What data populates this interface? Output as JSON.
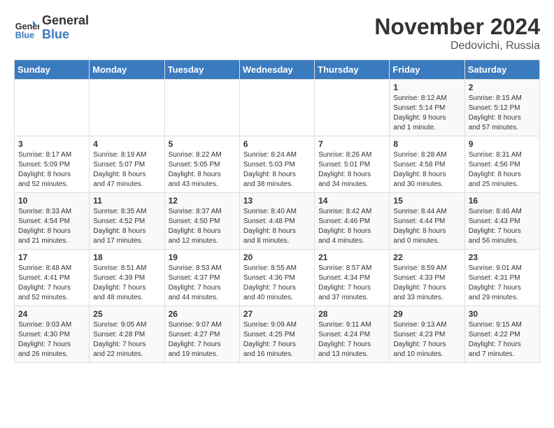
{
  "header": {
    "logo_line1": "General",
    "logo_line2": "Blue",
    "title": "November 2024",
    "location": "Dedovichi, Russia"
  },
  "days_of_week": [
    "Sunday",
    "Monday",
    "Tuesday",
    "Wednesday",
    "Thursday",
    "Friday",
    "Saturday"
  ],
  "weeks": [
    [
      {
        "day": "",
        "info": ""
      },
      {
        "day": "",
        "info": ""
      },
      {
        "day": "",
        "info": ""
      },
      {
        "day": "",
        "info": ""
      },
      {
        "day": "",
        "info": ""
      },
      {
        "day": "1",
        "info": "Sunrise: 8:12 AM\nSunset: 5:14 PM\nDaylight: 9 hours\nand 1 minute."
      },
      {
        "day": "2",
        "info": "Sunrise: 8:15 AM\nSunset: 5:12 PM\nDaylight: 8 hours\nand 57 minutes."
      }
    ],
    [
      {
        "day": "3",
        "info": "Sunrise: 8:17 AM\nSunset: 5:09 PM\nDaylight: 8 hours\nand 52 minutes."
      },
      {
        "day": "4",
        "info": "Sunrise: 8:19 AM\nSunset: 5:07 PM\nDaylight: 8 hours\nand 47 minutes."
      },
      {
        "day": "5",
        "info": "Sunrise: 8:22 AM\nSunset: 5:05 PM\nDaylight: 8 hours\nand 43 minutes."
      },
      {
        "day": "6",
        "info": "Sunrise: 8:24 AM\nSunset: 5:03 PM\nDaylight: 8 hours\nand 38 minutes."
      },
      {
        "day": "7",
        "info": "Sunrise: 8:26 AM\nSunset: 5:01 PM\nDaylight: 8 hours\nand 34 minutes."
      },
      {
        "day": "8",
        "info": "Sunrise: 8:28 AM\nSunset: 4:58 PM\nDaylight: 8 hours\nand 30 minutes."
      },
      {
        "day": "9",
        "info": "Sunrise: 8:31 AM\nSunset: 4:56 PM\nDaylight: 8 hours\nand 25 minutes."
      }
    ],
    [
      {
        "day": "10",
        "info": "Sunrise: 8:33 AM\nSunset: 4:54 PM\nDaylight: 8 hours\nand 21 minutes."
      },
      {
        "day": "11",
        "info": "Sunrise: 8:35 AM\nSunset: 4:52 PM\nDaylight: 8 hours\nand 17 minutes."
      },
      {
        "day": "12",
        "info": "Sunrise: 8:37 AM\nSunset: 4:50 PM\nDaylight: 8 hours\nand 12 minutes."
      },
      {
        "day": "13",
        "info": "Sunrise: 8:40 AM\nSunset: 4:48 PM\nDaylight: 8 hours\nand 8 minutes."
      },
      {
        "day": "14",
        "info": "Sunrise: 8:42 AM\nSunset: 4:46 PM\nDaylight: 8 hours\nand 4 minutes."
      },
      {
        "day": "15",
        "info": "Sunrise: 8:44 AM\nSunset: 4:44 PM\nDaylight: 8 hours\nand 0 minutes."
      },
      {
        "day": "16",
        "info": "Sunrise: 8:46 AM\nSunset: 4:43 PM\nDaylight: 7 hours\nand 56 minutes."
      }
    ],
    [
      {
        "day": "17",
        "info": "Sunrise: 8:48 AM\nSunset: 4:41 PM\nDaylight: 7 hours\nand 52 minutes."
      },
      {
        "day": "18",
        "info": "Sunrise: 8:51 AM\nSunset: 4:39 PM\nDaylight: 7 hours\nand 48 minutes."
      },
      {
        "day": "19",
        "info": "Sunrise: 8:53 AM\nSunset: 4:37 PM\nDaylight: 7 hours\nand 44 minutes."
      },
      {
        "day": "20",
        "info": "Sunrise: 8:55 AM\nSunset: 4:36 PM\nDaylight: 7 hours\nand 40 minutes."
      },
      {
        "day": "21",
        "info": "Sunrise: 8:57 AM\nSunset: 4:34 PM\nDaylight: 7 hours\nand 37 minutes."
      },
      {
        "day": "22",
        "info": "Sunrise: 8:59 AM\nSunset: 4:33 PM\nDaylight: 7 hours\nand 33 minutes."
      },
      {
        "day": "23",
        "info": "Sunrise: 9:01 AM\nSunset: 4:31 PM\nDaylight: 7 hours\nand 29 minutes."
      }
    ],
    [
      {
        "day": "24",
        "info": "Sunrise: 9:03 AM\nSunset: 4:30 PM\nDaylight: 7 hours\nand 26 minutes."
      },
      {
        "day": "25",
        "info": "Sunrise: 9:05 AM\nSunset: 4:28 PM\nDaylight: 7 hours\nand 22 minutes."
      },
      {
        "day": "26",
        "info": "Sunrise: 9:07 AM\nSunset: 4:27 PM\nDaylight: 7 hours\nand 19 minutes."
      },
      {
        "day": "27",
        "info": "Sunrise: 9:09 AM\nSunset: 4:25 PM\nDaylight: 7 hours\nand 16 minutes."
      },
      {
        "day": "28",
        "info": "Sunrise: 9:11 AM\nSunset: 4:24 PM\nDaylight: 7 hours\nand 13 minutes."
      },
      {
        "day": "29",
        "info": "Sunrise: 9:13 AM\nSunset: 4:23 PM\nDaylight: 7 hours\nand 10 minutes."
      },
      {
        "day": "30",
        "info": "Sunrise: 9:15 AM\nSunset: 4:22 PM\nDaylight: 7 hours\nand 7 minutes."
      }
    ]
  ]
}
